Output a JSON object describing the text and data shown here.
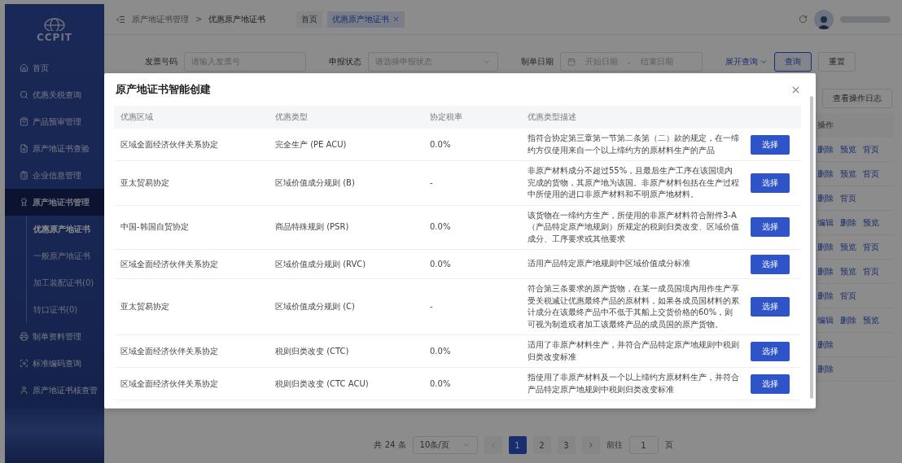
{
  "sidebar": {
    "logo": "CCPIT",
    "items": [
      {
        "label": "首页",
        "selected": false
      },
      {
        "label": "优惠关税查询",
        "selected": false
      },
      {
        "label": "产品预审管理",
        "selected": false
      },
      {
        "label": "原产地证书查验",
        "selected": false
      },
      {
        "label": "企业信息管理",
        "selected": false
      },
      {
        "label": "原产地证书管理",
        "selected": true,
        "expanded": true,
        "children": [
          {
            "label": "优惠原产地证书",
            "selected": true
          },
          {
            "label": "一般原产地证书",
            "selected": false
          },
          {
            "label": "加工装配证书(0)",
            "selected": false
          },
          {
            "label": "转口证书(0)",
            "selected": false
          }
        ]
      },
      {
        "label": "制单资料管理",
        "selected": false
      },
      {
        "label": "标准编码查询",
        "selected": false
      },
      {
        "label": "原产地证书核查管",
        "selected": false
      }
    ]
  },
  "topbar": {
    "breadcrumb": [
      "原产地证书管理",
      "优惠原产地证书"
    ],
    "separator": ">",
    "tabs": [
      {
        "label": "首页",
        "selected": false,
        "closable": false
      },
      {
        "label": "优惠原产地证书",
        "selected": true,
        "closable": true
      }
    ]
  },
  "filters": [
    {
      "kind": "text",
      "label": "发票号码",
      "placeholder": "请输入发票号"
    },
    {
      "kind": "select",
      "label": "申报状态",
      "placeholder": "请选择申报状态"
    },
    {
      "kind": "daterange",
      "label": "制单日期",
      "start_placeholder": "开始日期",
      "separator": "-",
      "end_placeholder": "结束日期"
    }
  ],
  "expand_link": "展开查询",
  "filter_buttons": [
    {
      "label": "查询",
      "kind": "primary"
    },
    {
      "label": "重置",
      "kind": "default"
    }
  ],
  "toolbar_button": "查看操作日志",
  "table": {
    "action_column": "操作",
    "rows": [
      {
        "actions": [
          "删除",
          "预览",
          "背页"
        ]
      },
      {
        "actions": [
          "删除",
          "预览",
          "背页"
        ]
      },
      {
        "actions": [
          "删除",
          "背页"
        ]
      },
      {
        "actions": [
          "编辑",
          "删除",
          "预览"
        ]
      },
      {
        "actions": [
          "删除",
          "预览",
          "背页"
        ]
      },
      {
        "actions": [
          "删除",
          "预览",
          "背页"
        ]
      },
      {
        "actions": [
          "删除",
          "背页"
        ]
      },
      {
        "actions": [
          "编辑",
          "删除",
          "预览"
        ]
      },
      {
        "actions": [
          "删除"
        ]
      },
      {
        "actions": [
          "删除"
        ]
      }
    ]
  },
  "pagination": {
    "total": "共 24 条",
    "page_size": "10条/页",
    "pages": [
      {
        "label": "1",
        "selected": true
      },
      {
        "label": "2",
        "selected": false
      },
      {
        "label": "3",
        "selected": false
      }
    ],
    "goto_label": "前往",
    "goto_value": "1",
    "goto_suffix": "页"
  },
  "modal": {
    "title": "原产地证书智能创建",
    "columns": [
      "优惠区域",
      "优惠类型",
      "协定税率",
      "优惠类型描述"
    ],
    "rows": [
      {
        "region": "区域全面经济伙伴关系协定",
        "type": "完全生产 (PE ACU)",
        "rate": "0.0%",
        "description": "指符合协定第三章第一节第二条第（二）款的规定，在一缔约方仅使用来自一个以上缔约方的原材料生产的产品",
        "action": "选择"
      },
      {
        "region": "亚太贸易协定",
        "type": "区域价值成分规则 (B)",
        "rate": "-",
        "description": "非原产材料成分不超过55%，且最后生产工序在该国境内完成的货物，其原产地为该国。非原产材料包括在生产过程中所使用的进口非原产材料和不明原产地材料。",
        "action": "选择"
      },
      {
        "region": "中国-韩国自贸协定",
        "type": "商品特殊规则 (PSR)",
        "rate": "0.0%",
        "description": "该货物在一缔约方生产，所使用的非原产材料符合附件3-A（产品特定原产地规则）所规定的税则归类改变、区域价值成分、工序要求或其他要求",
        "action": "选择"
      },
      {
        "region": "区域全面经济伙伴关系协定",
        "type": "区域价值成分规则 (RVC)",
        "rate": "0.0%",
        "description": "适用产品特定原产地规则中区域价值成分标准",
        "action": "选择"
      },
      {
        "region": "亚太贸易协定",
        "type": "区域价值成分规则 (C)",
        "rate": "-",
        "description": "符合第三条要求的原产货物，在某一成员国境内用作生产享受关税减让优惠最终产品的原材料，如果各成员国材料的累计成分在该最终产品中不低于其船上交货价格的60%，则可视为制造或者加工该最终产品的成员国的原产货物。",
        "action": "选择"
      },
      {
        "region": "区域全面经济伙伴关系协定",
        "type": "税则归类改变 (CTC)",
        "rate": "0.0%",
        "description": "适用了非原产材料生产，并符合产品特定原产地规则中税则归类改变标准",
        "action": "选择"
      },
      {
        "region": "区域全面经济伙伴关系协定",
        "type": "税则归类改变 (CTC ACU)",
        "rate": "0.0%",
        "description": "指使用了非原产材料及一个以上缔约方原材料生产，并符合产品特定原产地规则中税则归类改变标准",
        "action": "选择"
      }
    ]
  }
}
